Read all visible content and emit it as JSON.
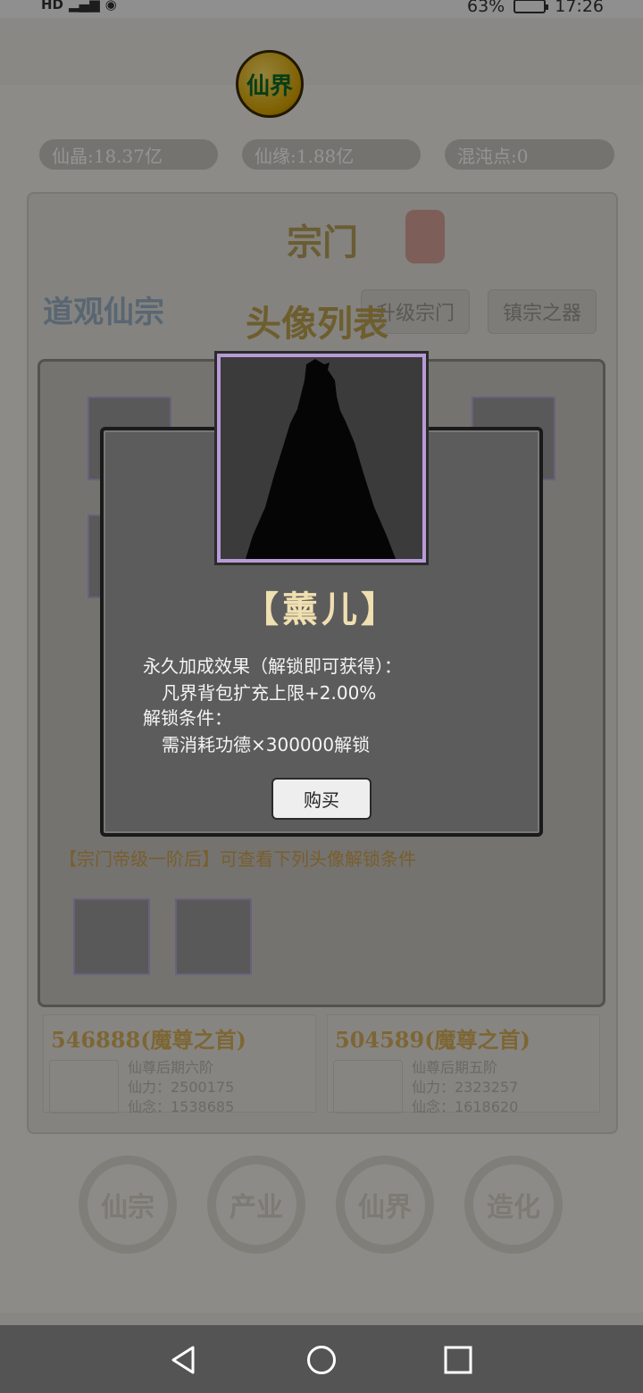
{
  "status_bar": {
    "left_text": "HD",
    "battery": "63%",
    "time": "17:26"
  },
  "header": {
    "logo_text": "仙界"
  },
  "currencies": [
    {
      "label": "仙晶:18.37亿"
    },
    {
      "label": "仙缘:1.88亿"
    },
    {
      "label": "混沌点:0"
    }
  ],
  "sect_panel": {
    "title": "宗门",
    "sect_name": "道观仙宗",
    "btn_left": "升级宗门",
    "btn_right": "镇宗之器",
    "avatar_list_title": "头像列表"
  },
  "hint": "【宗门帝级一阶后】可查看下列头像解锁条件",
  "lock_cards": [
    {
      "title": "546888(魔尊之首)",
      "info_lines": [
        "仙尊后期六阶",
        "仙力：2500175",
        "仙念：1538685"
      ]
    },
    {
      "title": "504589(魔尊之首)",
      "info_lines": [
        "仙尊后期五阶",
        "仙力：2323257",
        "仙念：1618620"
      ]
    }
  ],
  "bottom_nav": [
    "仙宗",
    "产业",
    "仙界",
    "造化"
  ],
  "dialog": {
    "name": "【薰儿】",
    "line1": "永久加成效果（解锁即可获得）：",
    "line2": "凡界背包扩充上限+2.00%",
    "line3": "解锁条件：",
    "line4": "需消耗功德×300000解锁",
    "buy_label": "购买"
  },
  "colors": {
    "dialog_bg": "#5c5c5c",
    "portrait_border": "#b99ad8",
    "name_color": "#f0dfb0"
  }
}
